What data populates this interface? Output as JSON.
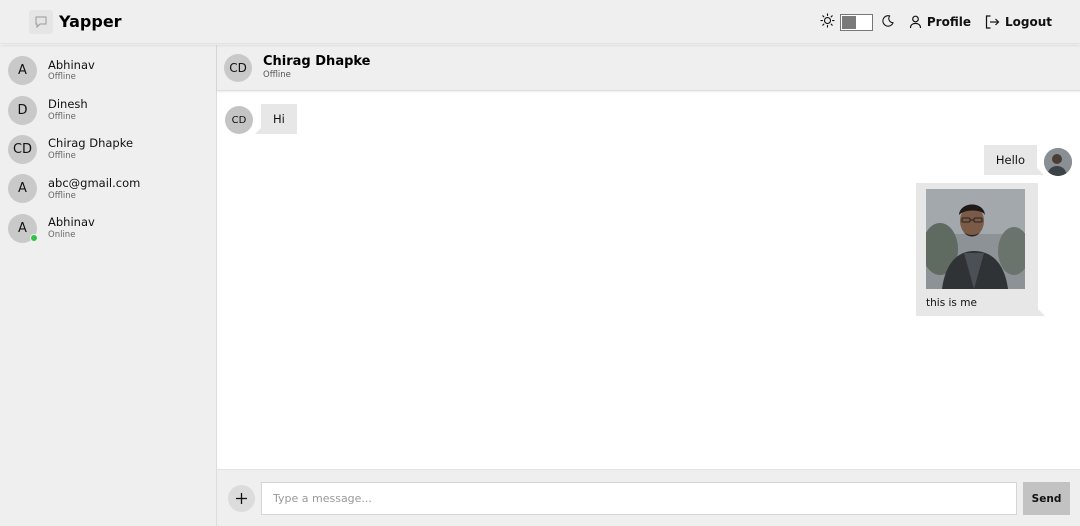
{
  "app": {
    "title": "Yapper"
  },
  "header": {
    "profile_label": "Profile",
    "logout_label": "Logout",
    "theme_toggle": {
      "mode": "light"
    }
  },
  "sidebar": {
    "contacts": [
      {
        "initials": "A",
        "name": "Abhinav",
        "status": "Offline",
        "online": false
      },
      {
        "initials": "D",
        "name": "Dinesh",
        "status": "Offline",
        "online": false
      },
      {
        "initials": "CD",
        "name": "Chirag Dhapke",
        "status": "Offline",
        "online": false
      },
      {
        "initials": "A",
        "name": "abc@gmail.com",
        "status": "Offline",
        "online": false
      },
      {
        "initials": "A",
        "name": "Abhinav",
        "status": "Online",
        "online": true
      }
    ]
  },
  "chat": {
    "initials": "CD",
    "name": "Chirag Dhapke",
    "status": "Offline",
    "messages": [
      {
        "from": "them",
        "initials": "CD",
        "text": "Hi"
      },
      {
        "from": "me",
        "text": "Hello"
      },
      {
        "from": "me",
        "type": "image",
        "caption": "this is me"
      }
    ]
  },
  "composer": {
    "placeholder": "Type a message...",
    "value": "",
    "send_label": "Send"
  },
  "colors": {
    "panel": "#efefef",
    "bubble": "#e7e7e7",
    "online": "#31c24a",
    "send": "#c2c2c2"
  }
}
